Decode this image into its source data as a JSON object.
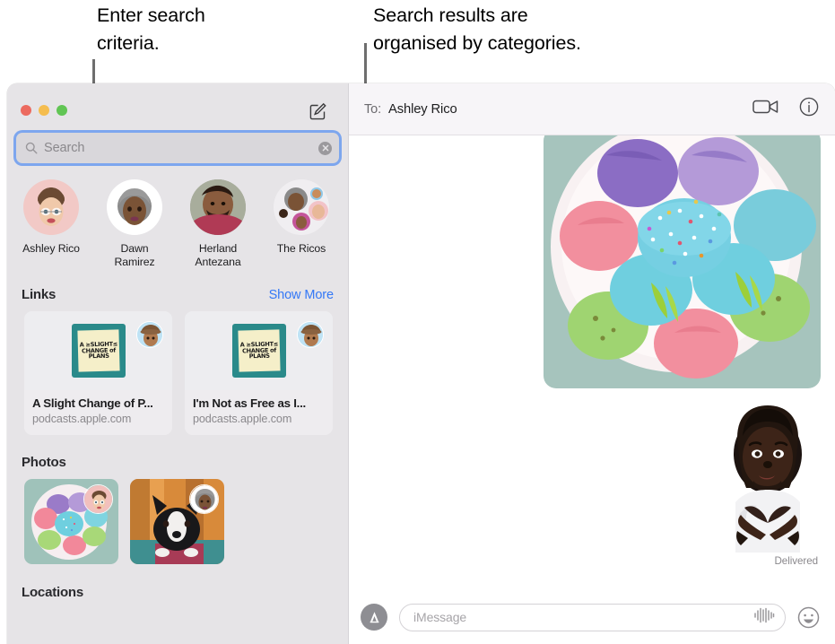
{
  "callouts": {
    "left": "Enter search\ncriteria.",
    "right": "Search results are\norganised by categories."
  },
  "sidebar": {
    "compose_icon": "compose-icon",
    "search": {
      "placeholder": "Search",
      "value": "",
      "icon": "search-icon",
      "clear_icon": "clear-icon"
    },
    "contacts": [
      {
        "name": "Ashley Rico",
        "avatar": "memoji-ashley"
      },
      {
        "name": "Dawn\nRamirez",
        "avatar": "memoji-dawn"
      },
      {
        "name": "Herland\nAntezana",
        "avatar": "photo-herland"
      },
      {
        "name": "The Ricos",
        "avatar": "group-ricos"
      }
    ],
    "links_section": {
      "title": "Links",
      "show_more": "Show More",
      "cards": [
        {
          "title": "A Slight Change of P...",
          "domain": "podcasts.apple.com",
          "art_lines": [
            "A  ≥SLIGHT≤",
            "CHANGE of",
            "PLANS"
          ]
        },
        {
          "title": "I'm Not as Free as I...",
          "domain": "podcasts.apple.com",
          "art_lines": [
            "A  ≥SLIGHT≤",
            "CHANGE of",
            "PLANS"
          ]
        }
      ]
    },
    "photos_section": {
      "title": "Photos",
      "items": [
        {
          "name": "macarons-photo"
        },
        {
          "name": "dog-photo"
        }
      ]
    },
    "locations_section": {
      "title": "Locations"
    }
  },
  "conversation": {
    "to_label": "To:",
    "recipient": "Ashley Rico",
    "facetime_icon": "video-camera-icon",
    "info_icon": "info-icon",
    "messages": [
      {
        "type": "photo",
        "name": "macarons-message-photo"
      },
      {
        "type": "sticker",
        "name": "memoji-heart-hands-sticker"
      }
    ],
    "delivered_status": "Delivered",
    "compose": {
      "appstore_icon": "app-store-icon",
      "placeholder": "iMessage",
      "value": "",
      "audio_icon": "audio-waveform-icon",
      "emoji_icon": "emoji-smiley-icon"
    }
  },
  "colors": {
    "accent_blue": "#3478F6",
    "sidebar_bg": "#E6E4E7",
    "focus_ring": "#5A92F0",
    "traffic_red": "#EC6A5F",
    "traffic_yellow": "#F5BD4F",
    "traffic_green": "#61C554"
  }
}
